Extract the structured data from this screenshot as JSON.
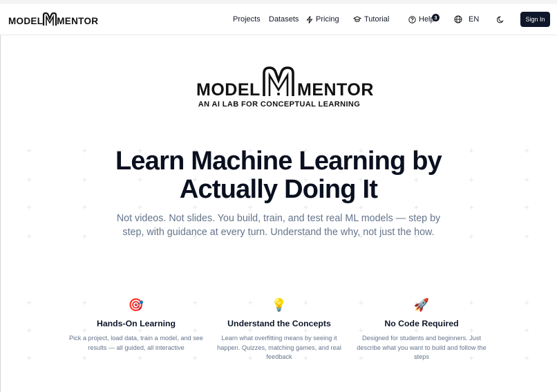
{
  "app": {
    "brand_left": "MODEL",
    "brand_right": "MENTOR",
    "tagline": "AN AI LAB FOR CONCEPTUAL LEARNING"
  },
  "nav": {
    "projects": "Projects",
    "datasets": "Datasets",
    "pricing": "Pricing",
    "tutorial": "Tutorial",
    "help": "Help",
    "help_badge": "3",
    "language": "EN",
    "sign_in": "Sign In"
  },
  "hero": {
    "title_line1": "Learn Machine Learning by",
    "title_line2": "Actually Doing It",
    "subtitle": "Not videos. Not slides. You build, train, and test real ML models — step by step, with guidance at every turn. Understand the why, not just the how."
  },
  "features": [
    {
      "icon": "🎯",
      "icon_name": "target-icon",
      "title": "Hands-On Learning",
      "description": "Pick a project, load data, train a model, and see results — all guided, all interactive"
    },
    {
      "icon": "💡",
      "icon_name": "lightbulb-icon",
      "title": "Understand the Concepts",
      "description": "Learn what overfitting means by seeing it happen. Quizzes, matching games, and real feedback"
    },
    {
      "icon": "🚀",
      "icon_name": "rocket-icon",
      "title": "No Code Required",
      "description": "Designed for students and beginners. Just describe what you want to build and follow the steps"
    }
  ],
  "colors": {
    "primary": "#0f172a",
    "muted_text": "#64748b",
    "border": "#e5e7eb"
  }
}
